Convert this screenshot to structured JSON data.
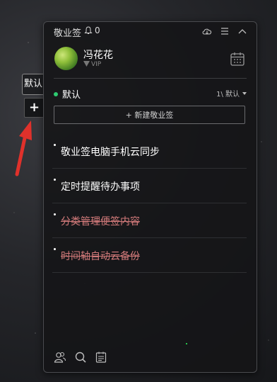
{
  "side": {
    "tab_label": "默认",
    "add_label": "+"
  },
  "panel": {
    "app_title": "敬业签",
    "bell_count": "0",
    "user": {
      "name": "冯花花",
      "vip": "VIP"
    },
    "category": {
      "name": "默认",
      "right_label": "1\\ 默认"
    },
    "new_button": "+ 新建敬业签",
    "notes": [
      {
        "text": "敬业签电脑手机云同步",
        "done": false
      },
      {
        "text": "定时提醒待办事项",
        "done": false
      },
      {
        "text": "分类管理便签内容",
        "done": true
      },
      {
        "text": "时间轴自动云备份",
        "done": true
      }
    ]
  },
  "colors": {
    "accent_green": "#2ecc71",
    "done_red": "#d27a7a",
    "arrow_red": "#e0312b"
  },
  "icons": [
    "bell-icon",
    "cloud-icon",
    "menu-icon",
    "collapse-icon",
    "calendar-icon",
    "contacts-icon",
    "search-icon",
    "timeline-icon"
  ]
}
